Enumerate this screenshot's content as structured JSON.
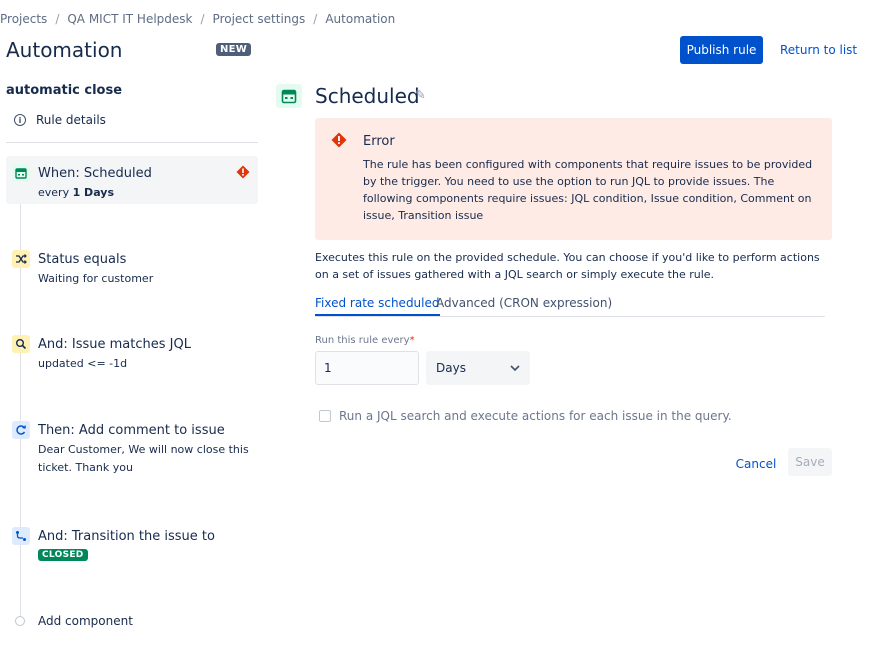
{
  "breadcrumb": [
    "Projects",
    "QA MICT IT Helpdesk",
    "Project settings",
    "Automation"
  ],
  "header": {
    "title": "Automation",
    "badge": "NEW",
    "publish_label": "Publish rule",
    "return_label": "Return to list"
  },
  "sidebar": {
    "rule_name": "automatic close",
    "rule_details": "Rule details",
    "steps": [
      {
        "title": "When: Scheduled",
        "sub_prefix": "every ",
        "sub_bold": "1 Days",
        "icon": "calendar-icon",
        "has_error": true
      },
      {
        "title": "Status equals",
        "sub": "Waiting for customer",
        "icon": "shuffle-icon"
      },
      {
        "title": "And: Issue matches JQL",
        "sub": "updated <= -1d",
        "icon": "search-icon"
      },
      {
        "title": "Then: Add comment to issue",
        "sub": "Dear Customer, We will now close this ticket. Thank you",
        "icon": "refresh-icon"
      },
      {
        "title": "And: Transition the issue to",
        "lozenge": "CLOSED",
        "icon": "transition-icon"
      }
    ],
    "add_component": "Add component"
  },
  "main": {
    "title": "Scheduled",
    "error": {
      "title": "Error",
      "message": "The rule has been configured with components that require issues to be provided by the trigger. You need to use the option to run JQL to provide issues. The following components require issues: JQL condition, Issue condition, Comment on issue, Transition issue"
    },
    "description": "Executes this rule on the provided schedule. You can choose if you'd like to perform actions on a set of issues gathered with a JQL search or simply execute the rule.",
    "tabs": [
      "Fixed rate scheduled",
      "Advanced (CRON expression)"
    ],
    "field_label": "Run this rule every",
    "field_required": "*",
    "interval_value": "1",
    "interval_unit": "Days",
    "checkbox_label": "Run a JQL search and execute actions for each issue in the query.",
    "cancel_label": "Cancel",
    "save_label": "Save"
  },
  "colors": {
    "primary": "#0052cc",
    "error_bg": "#ffebe6",
    "error_icon": "#de350b",
    "success": "#00875a"
  }
}
